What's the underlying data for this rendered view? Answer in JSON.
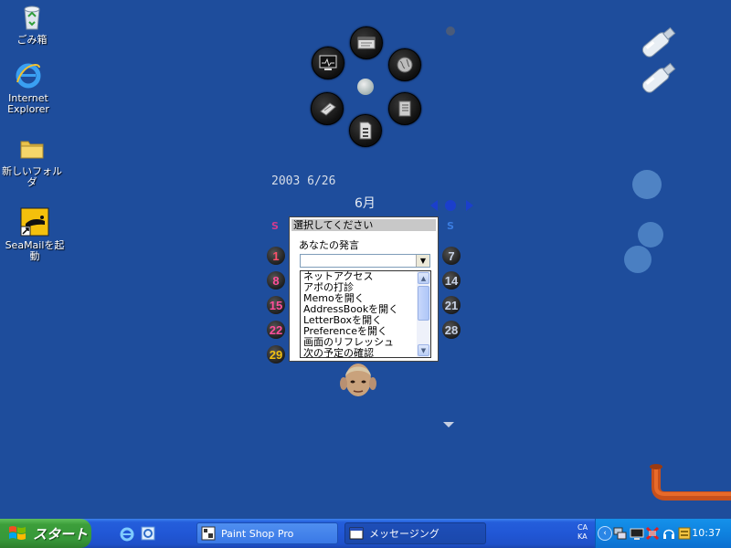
{
  "desktop": {
    "icons": [
      {
        "label": "ごみ箱",
        "icon": "recycle-bin-icon"
      },
      {
        "label": "Internet\nExplorer",
        "icon": "internet-explorer-icon"
      },
      {
        "label": "新しいフォルダ",
        "icon": "folder-icon"
      },
      {
        "label": "SeaMailを起動",
        "icon": "seamail-shortcut-icon"
      }
    ],
    "background_color": "#1e4d9c"
  },
  "calendar": {
    "date": "2003  6/26",
    "month": "6月",
    "sunday_head": "S",
    "saturday_head": "S",
    "sundays": [
      "1",
      "8",
      "15",
      "22",
      "29"
    ],
    "saturdays": [
      "7",
      "14",
      "21",
      "28"
    ]
  },
  "dialog": {
    "title": "選択してください",
    "prompt": "あなたの発言",
    "combo_value": "",
    "options": [
      "ネットアクセス",
      "アポの打診",
      "Memoを開く",
      "AddressBookを開く",
      "LetterBoxを開く",
      "Preferenceを開く",
      "画面のリフレッシュ",
      "次の予定の確認"
    ]
  },
  "taskbar": {
    "start_label": "スタート",
    "tasks": [
      {
        "label": "Paint Shop Pro",
        "icon": "paint-shop-pro-icon"
      },
      {
        "label": "メッセージング",
        "icon": "window-icon"
      }
    ],
    "ime": [
      "CA",
      "KA"
    ],
    "clock": "10:37",
    "colors": {
      "taskbar": "#245edb",
      "start": "#3c9e3a",
      "tray": "#0f82df"
    }
  }
}
